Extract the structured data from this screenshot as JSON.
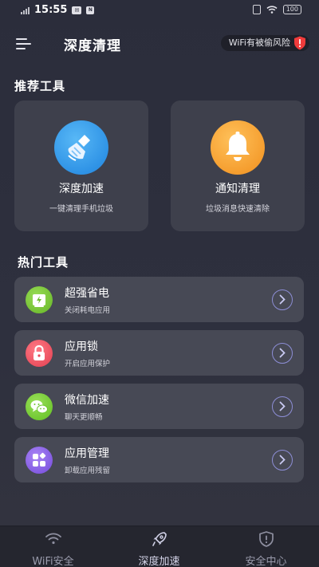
{
  "status_bar": {
    "time": "15:55",
    "battery": "100",
    "icons": [
      "signal-icon",
      "message-icon",
      "nfc-icon",
      "vibrate-icon",
      "wifi-icon",
      "battery-icon"
    ]
  },
  "header": {
    "title": "深度清理",
    "wifi_warning": "WiFi有被偷风险",
    "menu_icon": "menu-icon",
    "warning_icon": "warning-shield-icon"
  },
  "recommended": {
    "title": "推荐工具",
    "cards": [
      {
        "title": "深度加速",
        "subtitle": "一键清理手机垃圾",
        "icon": "broom-icon",
        "color": "#3aa0ee"
      },
      {
        "title": "通知清理",
        "subtitle": "垃圾消息快速清除",
        "icon": "bell-icon",
        "color": "#f5a235"
      }
    ]
  },
  "hot": {
    "title": "热门工具",
    "items": [
      {
        "title": "超强省电",
        "subtitle": "关闭耗电应用",
        "icon": "battery-charge-icon",
        "color": "#7dc63a"
      },
      {
        "title": "应用锁",
        "subtitle": "开启应用保护",
        "icon": "lock-icon",
        "color": "#ef5a68"
      },
      {
        "title": "微信加速",
        "subtitle": "聊天更顺畅",
        "icon": "wechat-icon",
        "color": "#7ed03a"
      },
      {
        "title": "应用管理",
        "subtitle": "卸载应用残留",
        "icon": "apps-icon",
        "color": "#8a63e6"
      }
    ]
  },
  "bottom_nav": {
    "items": [
      {
        "label": "WiFi安全",
        "icon": "wifi-icon",
        "active": false
      },
      {
        "label": "深度加速",
        "icon": "rocket-icon",
        "active": true
      },
      {
        "label": "安全中心",
        "icon": "shield-alert-icon",
        "active": false
      }
    ]
  },
  "colors": {
    "background": "#2b2d3b",
    "card": "#3e404c",
    "list_card": "#474955",
    "nav_background": "#25262f",
    "chevron_ring": "#8d8ed6"
  }
}
